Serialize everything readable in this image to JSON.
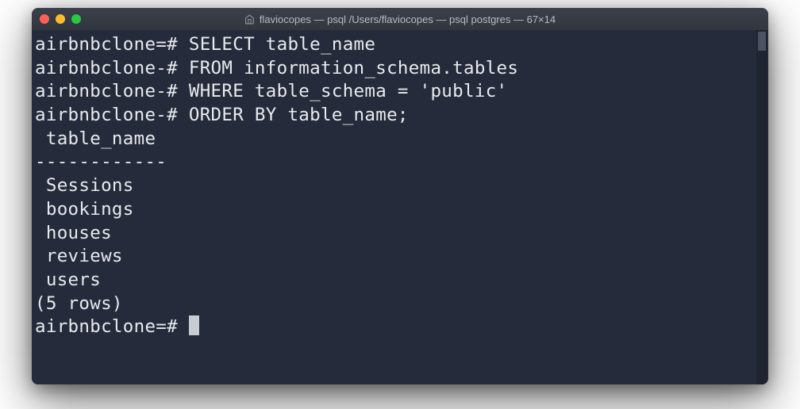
{
  "titlebar": {
    "title": "flaviocopes — psql  /Users/flaviocopes — psql postgres — 67×14"
  },
  "terminal": {
    "lines": [
      "airbnbclone=# SELECT table_name",
      "airbnbclone-# FROM information_schema.tables",
      "airbnbclone-# WHERE table_schema = 'public'",
      "airbnbclone-# ORDER BY table_name;",
      " table_name ",
      "------------",
      " Sessions",
      " bookings",
      " houses",
      " reviews",
      " users",
      "(5 rows)",
      ""
    ],
    "prompt": "airbnbclone=# "
  }
}
